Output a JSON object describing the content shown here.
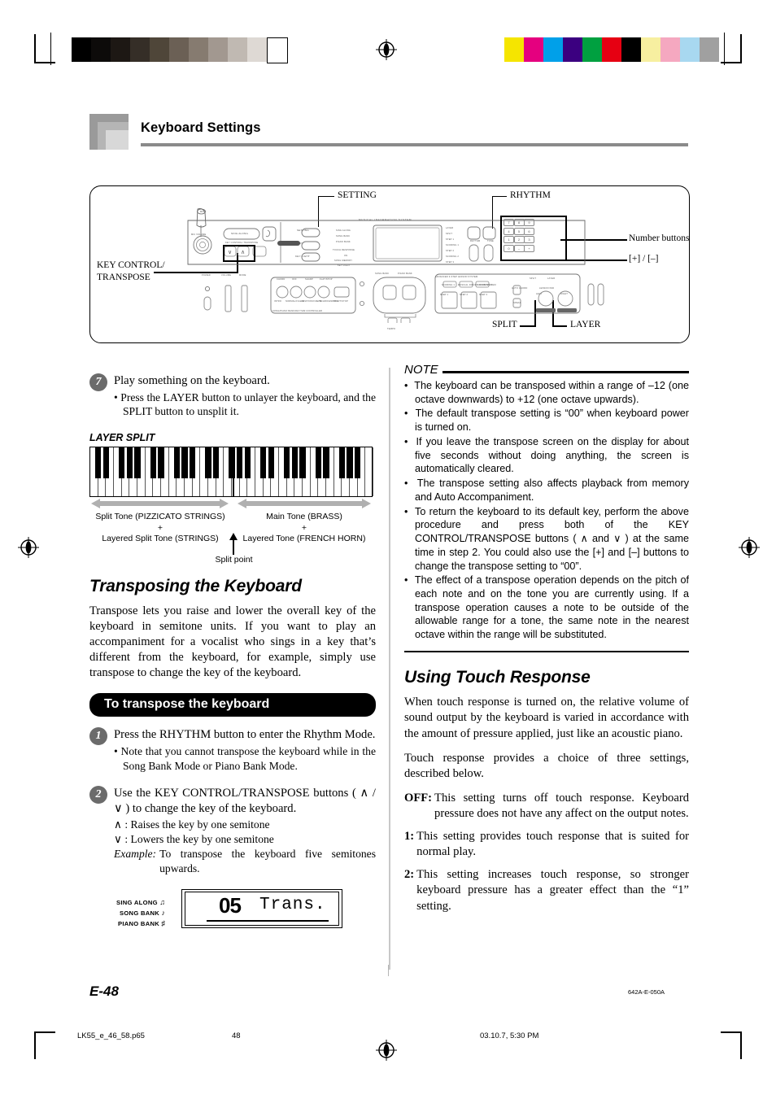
{
  "header": {
    "title": "Keyboard Settings"
  },
  "figure_panel": {
    "callouts": {
      "setting": "SETTING",
      "rhythm": "RHYTHM",
      "number_buttons": "Number buttons",
      "plus_minus": "[+] / [–]",
      "key_control_line1": "KEY CONTROL/",
      "key_control_line2": "TRANSPOSE",
      "split": "SPLIT",
      "layer": "LAYER"
    },
    "panel_microlabels": {
      "mic": "MIC",
      "mic_volume": "MIC VOLUME",
      "sing_along": "SING ALONG",
      "key_control_transpose": "KEY CONTROL/ TRANSPOSE",
      "setting": "SETTING",
      "song_memory": "SONG MEMORY",
      "key_light": "KEY LIGHT",
      "mis_title": "MUSICAL INFORMATION SYSTEM",
      "sing_along_item": "SING ALONG",
      "song_bank_item": "SONG BANK",
      "piano_bank_item": "PIANO BANK",
      "touch_response": "TOUCH RESPONSE",
      "on": "ON",
      "song_memory_item": "SONG MEMORY",
      "key_light_item": "KEY LIGHT",
      "layer": "LAYER",
      "split": "SPLIT",
      "step1": "STEP 1",
      "scoring1": "SCORING 1",
      "step2": "STEP 2",
      "scoring2": "SCORING 2",
      "step3": "STEP 3",
      "rhythm": "RHYTHM",
      "tone": "TONE",
      "power": "POWER",
      "volume": "VOLUME",
      "mode": "MODE",
      "chord": "CHORD",
      "off": "OFF",
      "sharp": "SHARP",
      "flat_stop": "FLAT/STOP",
      "intro": "INTRO",
      "normal_fill_in": "NORMAL/FILL-IN",
      "variation_fill_in": "VARIATION/FILL-IN",
      "synchro_ending": "SYNCHRO/ENDING",
      "start_stop": "START/STOP",
      "song_piano_bank_controller": "SONG/PIANO BANK/RHYTHM CONTROLLER",
      "song_bank": "SONG BANK",
      "piano_bank": "PIANO BANK",
      "tempo": "TEMPO",
      "scoring1b": "SCORING 1",
      "mis_system": "MUSICAL INFORMATION SYSTEM",
      "scoring3": "SCORING 3",
      "advanced_lesson": "ADVANCED 3-STEP LESSON SYSTEM",
      "auto_chord": "AUTO CHORD",
      "lesson_pad": "LESSON PAD",
      "left": "LEFT",
      "right": "RIGHT",
      "speak": "SPEAK",
      "step_1": "STEP 1",
      "step_2": "STEP 2",
      "step_3": "STEP 3",
      "split_btn": "SPLIT",
      "layer_btn": "LAYER"
    },
    "numpad": [
      "7",
      "8",
      "9",
      "4",
      "5",
      "6",
      "1",
      "2",
      "3",
      "0",
      "–",
      "+"
    ]
  },
  "left_column": {
    "step7": {
      "number": "7",
      "main": "Play something on the keyboard.",
      "sub": "• Press the LAYER button to unlayer the keyboard, and the SPLIT button to unsplit it."
    },
    "layer_split_heading": "LAYER SPLIT",
    "keyboard_diagram": {
      "split_caption_line1": "Split Tone (PIZZICATO STRINGS)",
      "split_caption_plus": "+",
      "split_caption_line2": "Layered Split Tone (STRINGS)",
      "main_caption_line1": "Main Tone (BRASS)",
      "main_caption_plus": "+",
      "main_caption_line2": "Layered Tone (FRENCH HORN)",
      "split_point": "Split point"
    },
    "transposing": {
      "title": "Transposing the Keyboard",
      "body": "Transpose lets you raise and lower the overall key of the keyboard in semitone units. If you want to play an accompaniment for a vocalist who sings in a key that’s different from the keyboard, for example, simply use transpose to change the key of the keyboard."
    },
    "procedure_bar": "To transpose the keyboard",
    "step1": {
      "number": "1",
      "main": "Press the RHYTHM button to enter the Rhythm Mode.",
      "sub": "• Note that you cannot transpose the keyboard while in the Song Bank Mode or Piano Bank Mode."
    },
    "step2": {
      "number": "2",
      "main": "Use the KEY CONTROL/TRANSPOSE buttons ( ∧ / ∨ ) to change the key of the keyboard.",
      "line_up": "∧ : Raises the key by one semitone",
      "line_down": "∨ : Lowers the key by one semitone",
      "example_label": "Example:",
      "example_text": "To transpose the keyboard five semitones upwards."
    },
    "lcd": {
      "modes": [
        "SING ALONG",
        "SONG BANK",
        "PIANO BANK"
      ],
      "number": "05",
      "word": "Trans."
    }
  },
  "right_column": {
    "note_heading": "NOTE",
    "notes": [
      "The keyboard can be transposed within a range of –12 (one octave downwards) to +12 (one octave upwards).",
      "The default transpose setting is “00” when keyboard power is turned on.",
      "If you leave the transpose screen on the display for about five seconds without doing anything, the screen is automatically cleared.",
      "The transpose setting also affects playback from memory and Auto Accompaniment.",
      "To return the keyboard to its default key, perform the above procedure and press both of the KEY CONTROL/TRANSPOSE buttons ( ∧ and ∨ ) at the same time in step 2. You could also use the [+] and [–] buttons to change the transpose setting to “00”.",
      "The effect of a transpose operation depends on the pitch of each note and on the tone you are currently using. If a transpose operation causes a note to be outside of the allowable range for a tone, the same note in the nearest octave within the range will be substituted."
    ],
    "touch_response": {
      "title": "Using Touch Response",
      "para1": "When touch response is turned on, the relative volume of sound output by the keyboard is varied in accordance with the amount of pressure applied, just like an acoustic piano.",
      "para2": "Touch response provides a choice of three settings, described below.",
      "settings": [
        {
          "key": "OFF:",
          "text": "This setting turns off touch response. Keyboard pressure does not have any affect on the output notes."
        },
        {
          "key": "1:",
          "text": "This setting provides touch response that is suited for normal play."
        },
        {
          "key": "2:",
          "text": "This setting increases touch response, so stronger keyboard pressure has a greater effect than the “1” setting."
        }
      ]
    }
  },
  "footer": {
    "page_number": "E-48",
    "doc_code": "642A-E-050A",
    "file_name": "LK55_e_46_58.p65",
    "sheet_number": "48",
    "timestamp": "03.10.7, 5:30 PM"
  },
  "print_marks": {
    "gray_steps": [
      "#000000",
      "#0d0b0a",
      "#1d1814",
      "#352e27",
      "#4f4639",
      "#6b6055",
      "#867b70",
      "#a29890",
      "#c0b9b2",
      "#ded9d4",
      "#ffffff"
    ],
    "color_steps": [
      "#f5e500",
      "#e5007f",
      "#00a0e9",
      "#3b0080",
      "#00a040",
      "#e60012",
      "#000000",
      "#f7efa0",
      "#f5a8c0",
      "#a8d8f0",
      "#a0a0a0"
    ]
  }
}
